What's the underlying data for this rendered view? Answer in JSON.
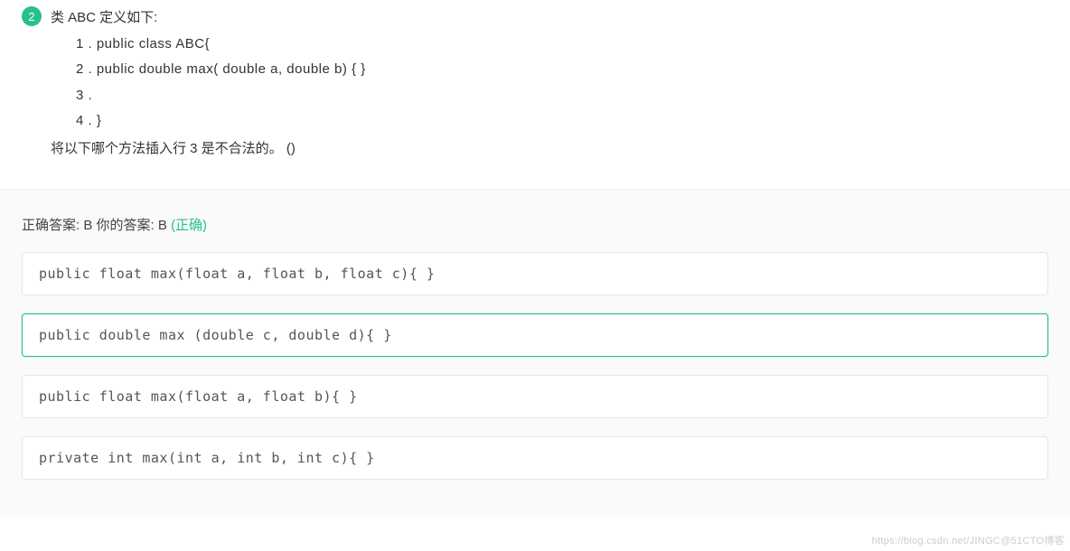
{
  "question": {
    "number": "2",
    "title": "类 ABC 定义如下:",
    "code_lines": [
      "1 .   public  class  ABC{",
      "2 .     public  double  max( double  a, double  b) {  }",
      "3 .",
      "4 .  }"
    ],
    "ask": "将以下哪个方法插入行 3 是不合法的。  ()"
  },
  "answer": {
    "correct_label": "正确答案: ",
    "correct_value": "B",
    "your_label": "   你的答案: ",
    "your_value": "B ",
    "status": "(正确)"
  },
  "options": [
    {
      "text": "public  float  max(float  a, float  b, float  c){  }",
      "selected": false
    },
    {
      "text": "public  double  max (double  c,  double  d){  }",
      "selected": true
    },
    {
      "text": "public  float  max(float  a,  float  b){  }",
      "selected": false
    },
    {
      "text": "private  int  max(int a, int b, int c){  }",
      "selected": false
    }
  ],
  "watermark": "https://blog.csdn.net/JINGC@51CTO博客"
}
